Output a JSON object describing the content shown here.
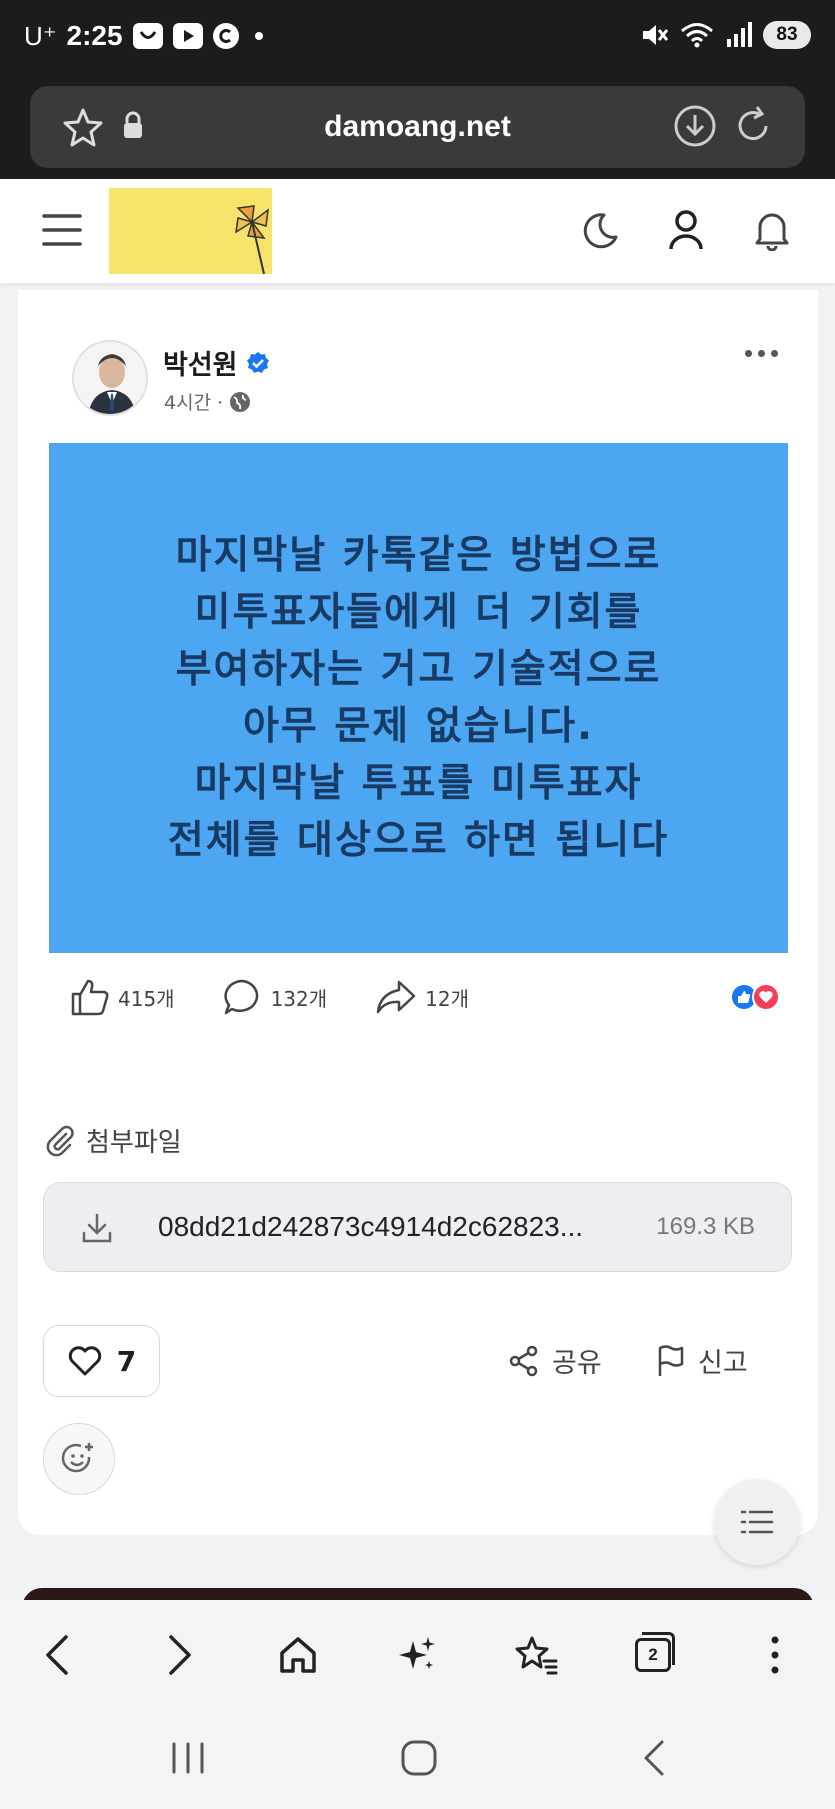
{
  "status_bar": {
    "carrier": "U⁺",
    "time": "2:25",
    "battery": "83"
  },
  "browser": {
    "url": "damoang.net"
  },
  "post": {
    "author": "박선원",
    "time_ago": "4시간 ·",
    "image_text": "마지막날 카톡같은 방법으로\n미투표자들에게  더 기회를\n부여하자는 거고 기술적으로\n아무 문제 없습니다.\n마지막날 투표를 미투표자\n전체를 대상으로 하면 됩니다",
    "image_bg_color": "#4da6f2",
    "likes": "415개",
    "comments": "132개",
    "shares": "12개"
  },
  "attachments": {
    "title": "첨부파일",
    "file_name": "08dd21d242873c4914d2c62823...",
    "file_size": "169.3 KB"
  },
  "actions": {
    "like_count": "7",
    "share_label": "공유",
    "report_label": "신고"
  },
  "toolbar": {
    "tab_count": "2"
  },
  "colors": {
    "brand_yellow": "#f5e36a",
    "verified_blue": "#1877f2"
  }
}
